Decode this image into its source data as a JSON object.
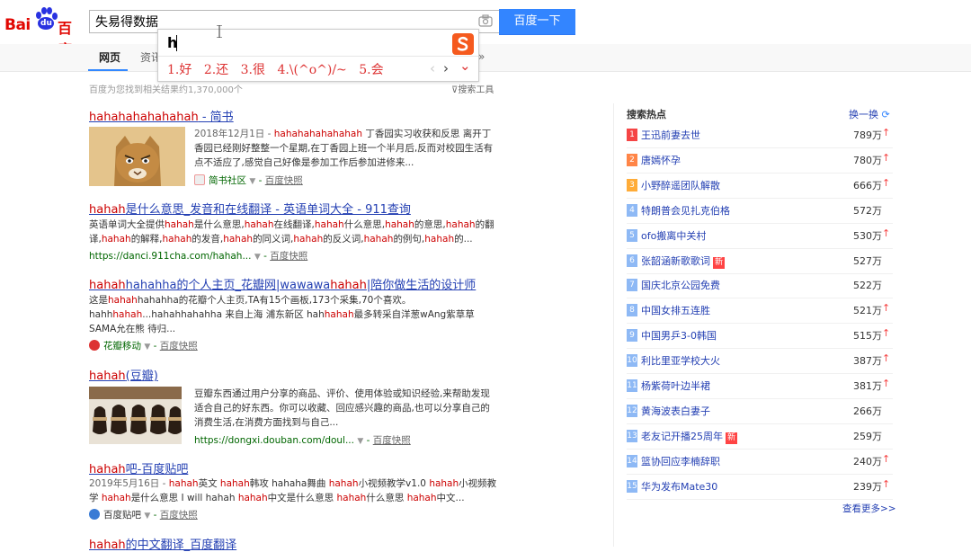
{
  "logo": {
    "left": "Bai",
    "paw_text": "du",
    "right": "百度"
  },
  "search": {
    "query": "失易得数据",
    "button_label": "百度一下"
  },
  "ime": {
    "input": "h",
    "candidates": [
      "1.好",
      "2.还",
      "3.很",
      "4.\\(^o^)/~",
      "5.会"
    ],
    "prev": "‹",
    "next": "›",
    "expand": "⌄"
  },
  "tabs": {
    "items": [
      "网页",
      "资讯"
    ],
    "more": "»"
  },
  "stats": {
    "text": "百度为您找到相关结果约1,370,000个",
    "tools": "搜索工具"
  },
  "results": [
    {
      "title_html": "<em>hahahahahahahah</em> - 简书",
      "abstract_html": "<span class=\"date\">2018年12月1日 - </span><em>hahahahahahahah</em> 丁香园实习收获和反思 离开丁香园已经刚好整整一个星期,在丁香园上班一个半月后,反而对校园生活有点不适应了,感觉自己好像是参加工作后参加进修来...",
      "source": "简书社区",
      "snapshot": "百度快照"
    },
    {
      "title_html": "<em>hahah</em>是什么意思_发音和在线翻译 - 英语单词大全 - 911查询",
      "abstract_html": "英语单词大全提供<em>hahah</em>是什么意思,<em>hahah</em>在线翻译,<em>hahah</em>什么意思,<em>hahah</em>的意思,<em>hahah</em>的翻译,<em>hahah</em>的解释,<em>hahah</em>的发音,<em>hahah</em>的同义词,<em>hahah</em>的反义词,<em>hahah</em>的例句,<em>hahah</em>的...",
      "url": "https://danci.911cha.com/hahah...",
      "snapshot": "百度快照"
    },
    {
      "title_html": "<em>hahah</em>hahahha的个人主页_花瓣网|wawawa<em>hahah</em>|陪你做生活的设计师",
      "abstract_html": "这是<em>hahah</em>hahahha的花瓣个人主页,TA有15个画板,173个采集,70个喜欢。hahh<em>hahah</em>...hahahhahahha 来自上海 浦东新区 hah<em>hahah</em>最多转采自洋葱wAng紫草草SAMA允在熊 待归...",
      "source": "花瓣移动",
      "snapshot": "百度快照"
    },
    {
      "title_html": "<em>hahah</em>(豆瓣)",
      "abstract_html": "豆瓣东西通过用户分享的商品、评价、使用体验或知识经验,来帮助发现适合自己的好东西。你可以收藏、回应感兴趣的商品,也可以分享自己的消费生活,在消费方面找到与自己...",
      "url": "https://dongxi.douban.com/doul...",
      "snapshot": "百度快照"
    },
    {
      "title_html": "<em>hahah</em>吧-百度贴吧",
      "abstract_html": "<span class=\"date\">2019年5月16日 - </span><em>hahah</em>英文 <em>hahah</em>韩攻 hahaha舞曲 <em>hahah</em>小视频教学v1.0 <em>hahah</em>小视频教学 <em>hahah</em>是什么意思 I will hahah <em>hahah</em>中文是什么意思 <em>hahah</em>什么意思 <em>hahah</em>中文...",
      "source": "百度贴吧",
      "snapshot": "百度快照"
    },
    {
      "title_html": "<em>hahah</em>的中文翻译_百度翻译"
    }
  ],
  "hot": {
    "title": "搜索热点",
    "refresh": "换一换",
    "see_more": "查看更多>>",
    "items": [
      {
        "rank": "1",
        "title": "王迅前妻去世",
        "count": "789万",
        "up": true,
        "new": false
      },
      {
        "rank": "2",
        "title": "唐嫣怀孕",
        "count": "780万",
        "up": true,
        "new": false
      },
      {
        "rank": "3",
        "title": "小野醉遥团队解散",
        "count": "666万",
        "up": true,
        "new": false
      },
      {
        "rank": "4",
        "title": "特朗普会见扎克伯格",
        "count": "572万",
        "up": false,
        "new": false
      },
      {
        "rank": "5",
        "title": "ofo搬离中关村",
        "count": "530万",
        "up": true,
        "new": false
      },
      {
        "rank": "6",
        "title": "张韶涵新歌歌词",
        "count": "527万",
        "up": false,
        "new": true
      },
      {
        "rank": "7",
        "title": "国庆北京公园免费",
        "count": "522万",
        "up": false,
        "new": false
      },
      {
        "rank": "8",
        "title": "中国女排五连胜",
        "count": "521万",
        "up": true,
        "new": false
      },
      {
        "rank": "9",
        "title": "中国男乒3-0韩国",
        "count": "515万",
        "up": true,
        "new": false
      },
      {
        "rank": "10",
        "title": "利比里亚学校大火",
        "count": "387万",
        "up": true,
        "new": false
      },
      {
        "rank": "11",
        "title": "杨紫荷叶边半裙",
        "count": "381万",
        "up": true,
        "new": false
      },
      {
        "rank": "12",
        "title": "黄海波表白妻子",
        "count": "266万",
        "up": false,
        "new": false
      },
      {
        "rank": "13",
        "title": "老友记开播25周年",
        "count": "259万",
        "up": false,
        "new": true
      },
      {
        "rank": "14",
        "title": "篮协回应李楠辞职",
        "count": "240万",
        "up": true,
        "new": false
      },
      {
        "rank": "15",
        "title": "华为发布Mate30",
        "count": "239万",
        "up": true,
        "new": false
      }
    ]
  },
  "colors": {
    "accent": "#3385ff",
    "link": "#2440b3",
    "em": "#cc0000",
    "rank_top1": "#f54545",
    "rank_top2": "#ff8547",
    "rank_top3": "#ffac38",
    "rank_other": "#8eb9f5"
  }
}
